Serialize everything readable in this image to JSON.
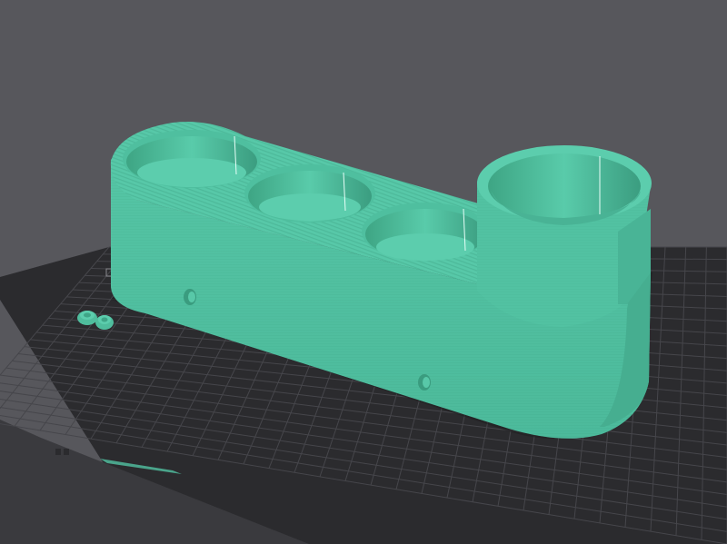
{
  "viewport": {
    "view": "3D preview",
    "background_color": "#57575c"
  },
  "bed": {
    "logo_text": "",
    "left_caption": "",
    "right_caption": "",
    "plate_color": "#2b2b2e",
    "grid_color": "#4a4a4f"
  },
  "model": {
    "name": "",
    "color": "#53c3a3",
    "cup_count": 4
  },
  "small_parts": {
    "count": 2,
    "color": "#53c3a3"
  }
}
